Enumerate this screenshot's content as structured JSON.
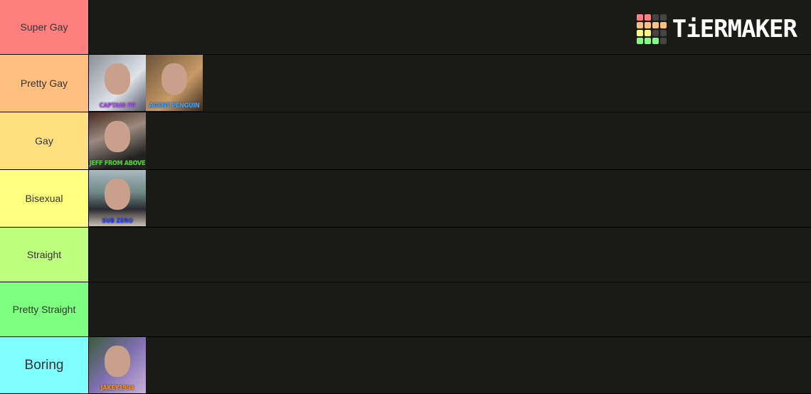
{
  "logo": {
    "text": "TiERMAKER",
    "grid": [
      "#ff7f7f",
      "#ff7f7f",
      "#444",
      "#444",
      "#ffbf7f",
      "#ffbf7f",
      "#ffbf7f",
      "#ffbf7f",
      "#ffff7f",
      "#ffff7f",
      "#444",
      "#444",
      "#7fff7f",
      "#7fff7f",
      "#7fff7f",
      "#444"
    ]
  },
  "tiers": [
    {
      "label": "Super Gay",
      "color": "#ff7f7f",
      "items": []
    },
    {
      "label": "Pretty Gay",
      "color": "#ffbf7f",
      "items": [
        {
          "caption": "CAPTAIN PP",
          "caption_color": "#b04cff",
          "bg": "linear-gradient(135deg,#8a8f96,#dde3e8 60%,#556)"
        },
        {
          "caption": "AGENT PENGUIN",
          "caption_color": "#3fa0ff",
          "bg": "linear-gradient(135deg,#6b5238,#c89a66 60%,#3a2a1e)"
        }
      ]
    },
    {
      "label": "Gay",
      "color": "#ffdf7f",
      "items": [
        {
          "caption": "JEFF FROM ABOVE",
          "caption_color": "#48d42b",
          "bg": "linear-gradient(160deg,#4a2a1e,#9a8a80 40%,#222 80%)"
        }
      ]
    },
    {
      "label": "Bisexual",
      "color": "#ffff7f",
      "items": [
        {
          "caption": "SUB ZERO",
          "caption_color": "#2b3cff",
          "bg": "linear-gradient(180deg,#aab8c0,#6f8a86 40%,#2a2a30 70%,#c9c0b0)"
        }
      ]
    },
    {
      "label": "Straight",
      "color": "#bfff7f",
      "items": []
    },
    {
      "label": "Pretty Straight",
      "color": "#7fff7f",
      "items": []
    },
    {
      "label": "Boring",
      "color": "#7fffff",
      "items": [
        {
          "caption": "JAKEY1994",
          "caption_color": "#ff8c1a",
          "bg": "linear-gradient(135deg,#3a5a3a,#7f6fb0 50%,#c9b0d8)"
        }
      ]
    }
  ]
}
